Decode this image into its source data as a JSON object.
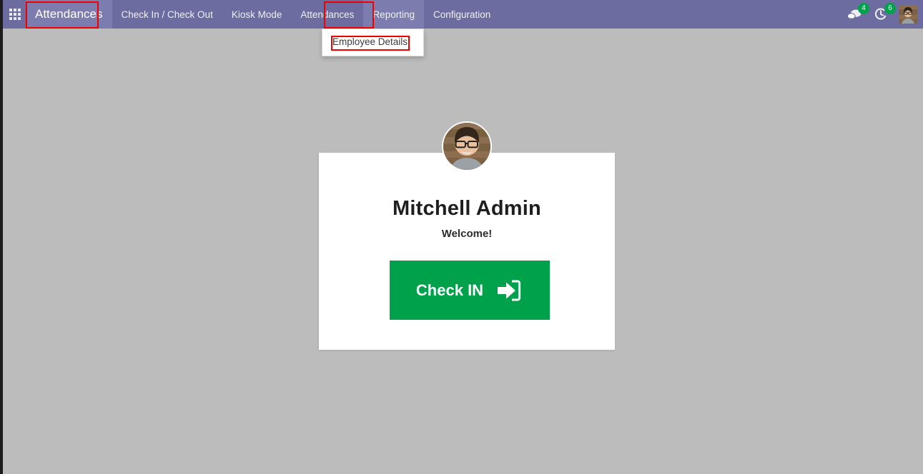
{
  "window": {
    "app_title": "Attendances"
  },
  "navbar": {
    "apps_icon": "apps-grid-icon",
    "brand_label": "Attendances",
    "menu_items": [
      {
        "label": "Check In / Check Out",
        "active": false
      },
      {
        "label": "Kiosk Mode",
        "active": false
      },
      {
        "label": "Attendances",
        "active": false
      },
      {
        "label": "Reporting",
        "active": true
      },
      {
        "label": "Configuration",
        "active": false
      }
    ],
    "messages": {
      "icon": "chat-bubble-icon",
      "count": "4"
    },
    "activities": {
      "icon": "clock-activity-icon",
      "count": "6"
    },
    "user": {
      "avatar_icon": "user-avatar",
      "name": "Mitchell Admin"
    }
  },
  "dropdown": {
    "open_for": "Reporting",
    "items": [
      {
        "label": "Employee Details",
        "highlighted": true
      }
    ]
  },
  "card": {
    "avatar_icon": "employee-photo",
    "employee_name": "Mitchell Admin",
    "welcome_text": "Welcome!",
    "checkin_button_label": "Check IN",
    "checkin_button_icon": "sign-in-arrow-icon"
  },
  "colors": {
    "navbar_purple": "#6c6ca0",
    "navbar_active_purple": "#7c7cae",
    "page_background": "#bcbcbc",
    "card_background": "#ffffff",
    "accent_green": "#00a14b",
    "annotation_red": "#f20000",
    "left_rail": "#1c1c1c"
  },
  "annotations": [
    {
      "target": "brand-attendances",
      "color": "#f20000"
    },
    {
      "target": "menu-item-reporting",
      "color": "#f20000"
    },
    {
      "target": "dropdown-item-employee-details",
      "color": "#f20000"
    }
  ]
}
